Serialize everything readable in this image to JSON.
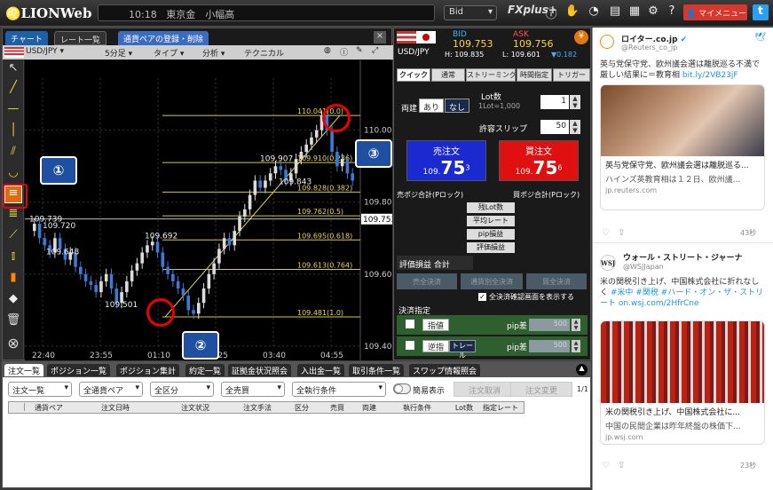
{
  "header": {
    "brand": "LIONWeb",
    "clock": "10:18",
    "market_time": "東京金　小幅高",
    "bid_select": "Bid",
    "fx_plus": "FXplus+",
    "my_menu": "マイメニュー"
  },
  "chart": {
    "tabs": [
      "チャート",
      "レート一覧",
      "通貨ペアの登録・削除"
    ],
    "pair": "USD/JPY",
    "timeframe": "5分足",
    "type_menu": "タイプ",
    "analysis_menu": "分析",
    "technical_menu": "テクニカル",
    "y_ticks": [
      "110.000",
      "109.800",
      "109.600",
      "109.400"
    ],
    "current_price": "109.753",
    "x_ticks": [
      "22:40",
      "23:55",
      "01:10",
      "02:25",
      "03:40",
      "04:55"
    ],
    "price_labels": [
      "109.739",
      "109.720",
      "109.648",
      "109.501",
      "109.692",
      "109.907",
      "109.843"
    ],
    "fib_levels": [
      {
        "label": "110.041(0.0)",
        "price": 110.041
      },
      {
        "label": "109.910(0.236)",
        "price": 109.91
      },
      {
        "label": "109.828(0.382)",
        "price": 109.828
      },
      {
        "label": "109.762(0.5)",
        "price": 109.762
      },
      {
        "label": "109.695(0.618)",
        "price": 109.695
      },
      {
        "label": "109.613(0.764)",
        "price": 109.613
      },
      {
        "label": "109.481(1.0)",
        "price": 109.481
      }
    ],
    "markers": [
      "①",
      "②",
      "③"
    ]
  },
  "order": {
    "pair": "USD/JPY",
    "bid_label": "BID",
    "bid_rate": "109.753",
    "ask_label": "ASK",
    "ask_rate": "109.756",
    "high": "H: 109.835",
    "low": "L: 109.601",
    "change": "▼0.182",
    "tabs": [
      "クイック",
      "通常",
      "ストリーミング",
      "時間指定",
      "トリガー"
    ],
    "both_label": "両建",
    "both_on": "あり",
    "both_off": "なし",
    "lot_label": "Lot数",
    "lot_unit": "1Lot=1,000",
    "lot_value": "1",
    "slip_label": "許容スリップ",
    "slip_value": "50",
    "sell_label": "売注文",
    "sell_small": "109.",
    "sell_big": "75",
    "sell_sup": "3",
    "buy_label": "買注文",
    "buy_small": "109.",
    "buy_big": "75",
    "buy_sup": "6",
    "sell_pos": "売ポジ合計(Pロック)",
    "buy_pos": "買ポジ合計(Pロック)",
    "rows": [
      "残Lot数",
      "平均レート",
      "pip損益",
      "評価損益"
    ],
    "eval_total": "評価損益 合計",
    "settle_buttons": [
      "売全決済",
      "通貨別全決済",
      "買全決済"
    ],
    "confirm_check": "全決済確認画面を表示する",
    "settle_label": "決済指定",
    "limit_btn": "指値",
    "stop_btn": "逆指",
    "trail_btn": "トレール",
    "pip_diff": "pip差",
    "pip_value": "500"
  },
  "bottom": {
    "tabs": [
      "注文一覧",
      "ポジション一覧",
      "ポジション集計",
      "約定一覧",
      "証拠金状況照会",
      "入出金一覧",
      "取引条件一覧",
      "スワップ情報照会"
    ],
    "filters": [
      "注文一覧",
      "全通貨ペア",
      "全区分",
      "全売買",
      "全執行条件"
    ],
    "simple_view": "簡易表示",
    "cancel_btn": "注文取消",
    "change_btn": "注文変更",
    "page": "1/1",
    "columns": [
      "通貨ペア",
      "注文日時",
      "注文状況",
      "注文手法",
      "区分",
      "売買",
      "両建",
      "執行条件",
      "Lot数",
      "指定レート"
    ]
  },
  "twitter": {
    "t1_name": "ロイター.co.jp",
    "t1_handle": "@Reuters_co_jp",
    "t1_text": "英与党保守党、欧州議会選は離脱巡る不満で厳しい結果に＝教育相 ",
    "t1_link": "bit.ly/2VB23jF",
    "t1_card_title": "英与党保守党、欧州議会選は離脱巡る...",
    "t1_card_desc": "ハインズ英教育相は１２日、欧州議...",
    "t1_card_domain": "jp.reuters.com",
    "t1_time": "43秒",
    "t2_name": "ウォール・ストリート・ジャーナ",
    "t2_handle": "@WSJJapan",
    "t2_text": "米の関税引き上げ、中国株式会社に折れなしく ",
    "t2_tags": "#米中 #関税 #ハード・オン・ザ・ストリート",
    "t2_link": "on.wsj.com/2HfrCne",
    "t2_card_title": "米の関税引き上げ、中国株式会社に...",
    "t2_card_desc": "中国の民間企業は昨年終盤の株価下...",
    "t2_card_domain": "jp.wsj.com",
    "t2_time": "23秒"
  }
}
